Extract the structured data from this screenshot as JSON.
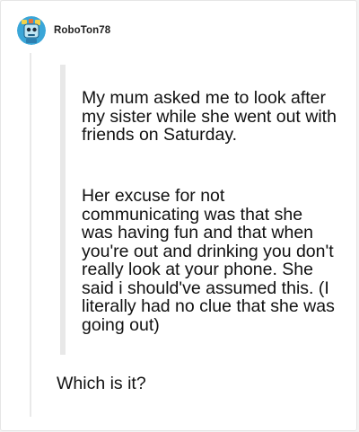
{
  "post": {
    "author": {
      "username": "RoboTon78",
      "avatar_icon": "robot-avatar-icon"
    },
    "quote": {
      "paragraphs": [
        "My mum asked me to look after my sister while she went out with friends on Saturday.",
        "Her excuse for not communicating was that she was having fun and that when you're out and drinking you don't really look at your phone. She said i should've assumed this. (I literally had no clue that she was going out)"
      ]
    },
    "reply": "Which is it?"
  },
  "colors": {
    "background": "#f3f3f3",
    "card": "#ffffff",
    "quote_bar": "#e8e8e8",
    "text": "#111111",
    "avatar_bg": "#3aa6d8"
  }
}
